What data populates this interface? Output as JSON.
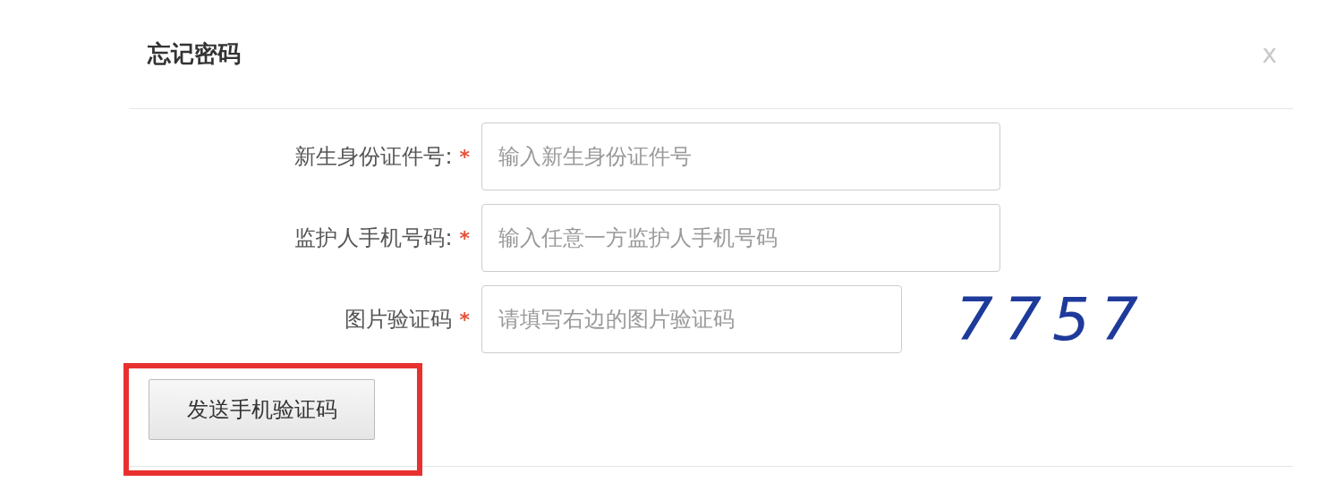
{
  "dialog": {
    "title": "忘记密码",
    "close": "x"
  },
  "fields": [
    {
      "label": "新生身份证件号:",
      "required_mark": "*",
      "placeholder": "输入新生身份证件号",
      "kind": "wide"
    },
    {
      "label": "监护人手机号码:",
      "required_mark": "*",
      "placeholder": "输入任意一方监护人手机号码",
      "kind": "wide"
    },
    {
      "label": "图片验证码",
      "required_mark": "*",
      "placeholder": "请填写右边的图片验证码",
      "kind": "captcha",
      "captcha": "7757"
    }
  ],
  "send_button": {
    "label": "发送手机验证码",
    "highlighted": true
  }
}
